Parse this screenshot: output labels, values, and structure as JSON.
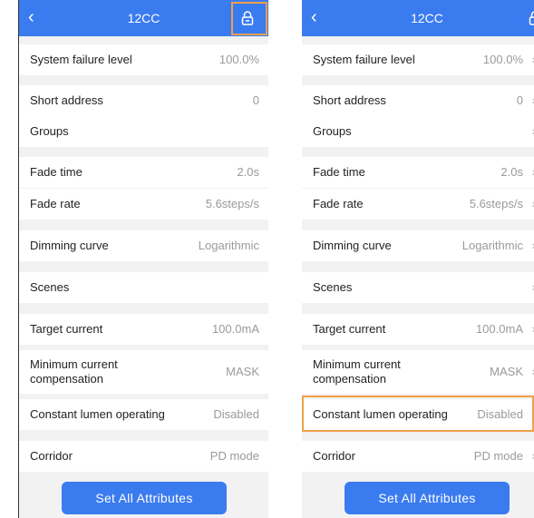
{
  "header": {
    "title": "12CC",
    "back_icon": "chevron-left-icon",
    "lock_icon": "lock-icon"
  },
  "rows": [
    {
      "label": "System failure level",
      "value": "100.0%"
    },
    {
      "label": "Short address",
      "value": "0"
    },
    {
      "label": "Groups",
      "value": ""
    },
    {
      "label": "Fade time",
      "value": "2.0s"
    },
    {
      "label": "Fade rate",
      "value": "5.6steps/s"
    },
    {
      "label": "Dimming curve",
      "value": "Logarithmic"
    },
    {
      "label": "Scenes",
      "value": ""
    },
    {
      "label": "Target current",
      "value": "100.0mA"
    },
    {
      "label": "Minimum current compensation",
      "value": "MASK"
    },
    {
      "label": "Constant lumen operating",
      "value": "Disabled"
    },
    {
      "label": "Corridor",
      "value": "PD mode"
    }
  ],
  "footer": {
    "button_label": "Set All Attributes"
  },
  "colors": {
    "accent": "#3a7bf0",
    "highlight": "#f0a04b"
  }
}
